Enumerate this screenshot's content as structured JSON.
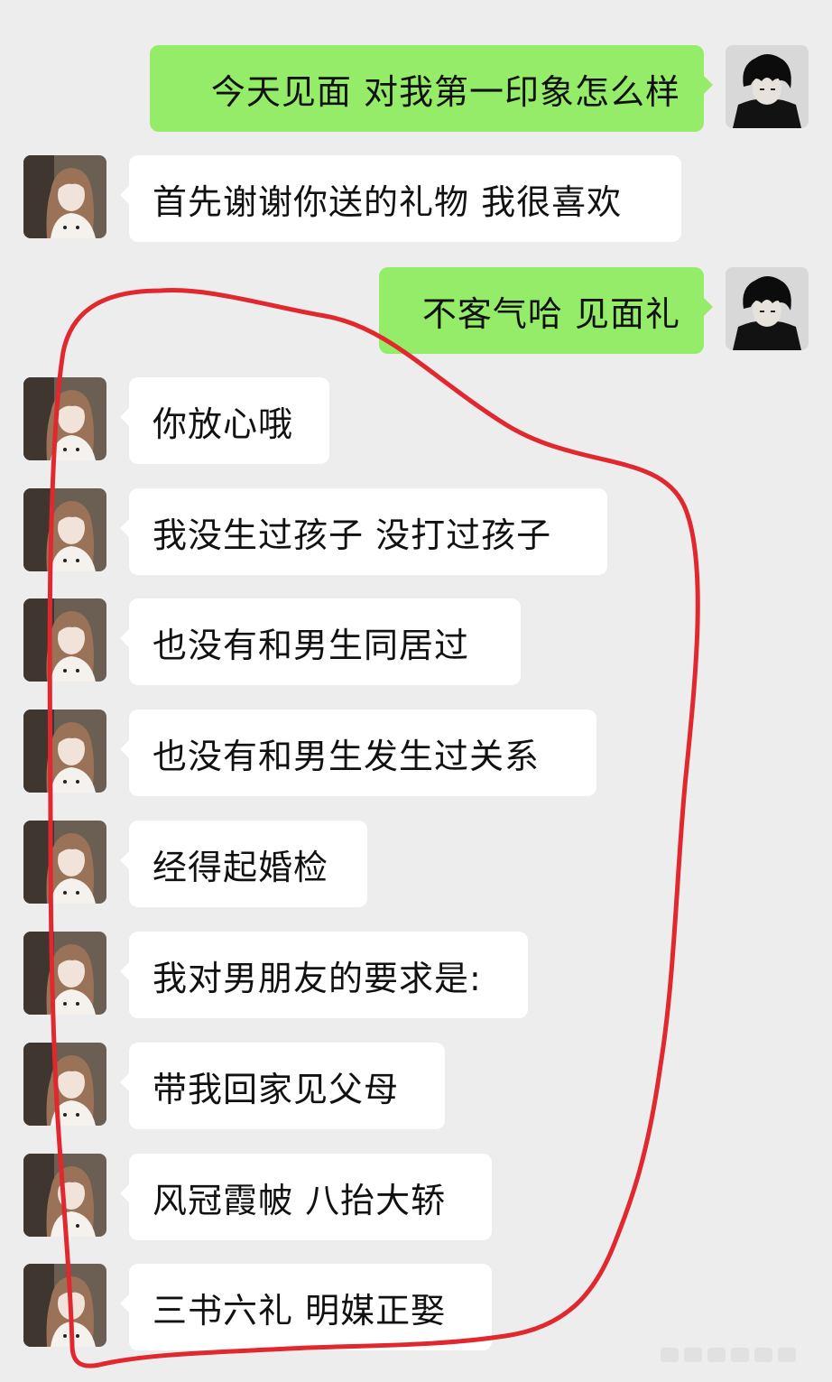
{
  "chat": {
    "messages": [
      {
        "side": "right",
        "sender": "me",
        "text": "今天见面 对我第一印象怎么样"
      },
      {
        "side": "left",
        "sender": "her",
        "text": "首先谢谢你送的礼物 我很喜欢"
      },
      {
        "side": "right",
        "sender": "me",
        "text": "不客气哈 见面礼"
      },
      {
        "side": "left",
        "sender": "her",
        "text": "你放心哦"
      },
      {
        "side": "left",
        "sender": "her",
        "text": "我没生过孩子 没打过孩子"
      },
      {
        "side": "left",
        "sender": "her",
        "text": "也没有和男生同居过"
      },
      {
        "side": "left",
        "sender": "her",
        "text": "也没有和男生发生过关系"
      },
      {
        "side": "left",
        "sender": "her",
        "text": "经得起婚检"
      },
      {
        "side": "left",
        "sender": "her",
        "text": "我对男朋友的要求是:"
      },
      {
        "side": "left",
        "sender": "her",
        "text": "带我回家见父母"
      },
      {
        "side": "left",
        "sender": "her",
        "text": "风冠霞帔 八抬大轿"
      },
      {
        "side": "left",
        "sender": "her",
        "text": "三书六礼 明媒正娶"
      }
    ]
  },
  "colors": {
    "background": "#ededed",
    "received_bubble": "#ffffff",
    "sent_bubble": "#95ec69",
    "annotation_outline": "#e0282e"
  },
  "icons": {
    "my_avatar": "anime-boy-avatar-icon",
    "her_avatar": "girl-photo-avatar-icon"
  }
}
